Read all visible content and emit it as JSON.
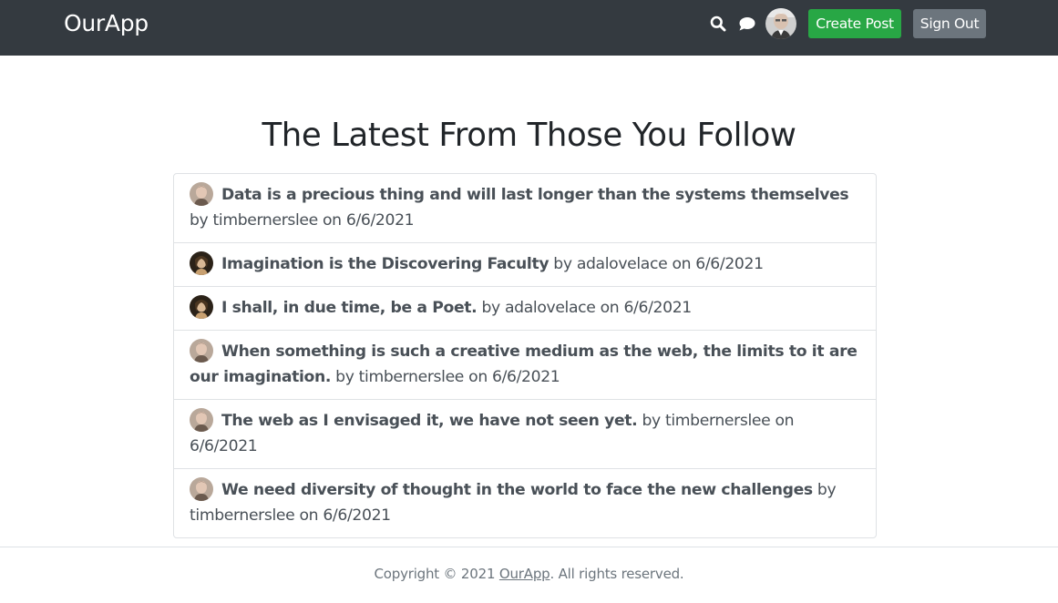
{
  "navbar": {
    "brand": "OurApp",
    "search_icon": "search-icon",
    "chat_icon": "chat-icon",
    "avatar_alt": "user avatar",
    "create_post_label": "Create Post",
    "sign_out_label": "Sign Out",
    "background_color": "#343a40",
    "create_color": "#28a745",
    "signout_color": "#6c757d"
  },
  "main": {
    "heading": "The Latest From Those You Follow",
    "posts": [
      {
        "title": "Data is a precious thing and will last longer than the systems themselves",
        "by_label": "by",
        "author": "timbernerslee",
        "on_label": "on",
        "date": "6/6/2021",
        "avatar": "timbernerslee"
      },
      {
        "title": "Imagination is the Discovering Faculty",
        "by_label": "by",
        "author": "adalovelace",
        "on_label": "on",
        "date": "6/6/2021",
        "avatar": "adalovelace"
      },
      {
        "title": "I shall, in due time, be a Poet.",
        "by_label": "by",
        "author": "adalovelace",
        "on_label": "on",
        "date": "6/6/2021",
        "avatar": "adalovelace"
      },
      {
        "title": "When something is such a creative medium as the web, the limits to it are our imagination.",
        "by_label": "by",
        "author": "timbernerslee",
        "on_label": "on",
        "date": "6/6/2021",
        "avatar": "timbernerslee"
      },
      {
        "title": "The web as I envisaged it, we have not seen yet.",
        "by_label": "by",
        "author": "timbernerslee",
        "on_label": "on",
        "date": "6/6/2021",
        "avatar": "timbernerslee"
      },
      {
        "title": "We need diversity of thought in the world to face the new challenges",
        "by_label": "by",
        "author": "timbernerslee",
        "on_label": "on",
        "date": "6/6/2021",
        "avatar": "timbernerslee"
      }
    ]
  },
  "footer": {
    "prefix": "Copyright © 2021",
    "link": "OurApp",
    "suffix": ". All rights reserved."
  }
}
